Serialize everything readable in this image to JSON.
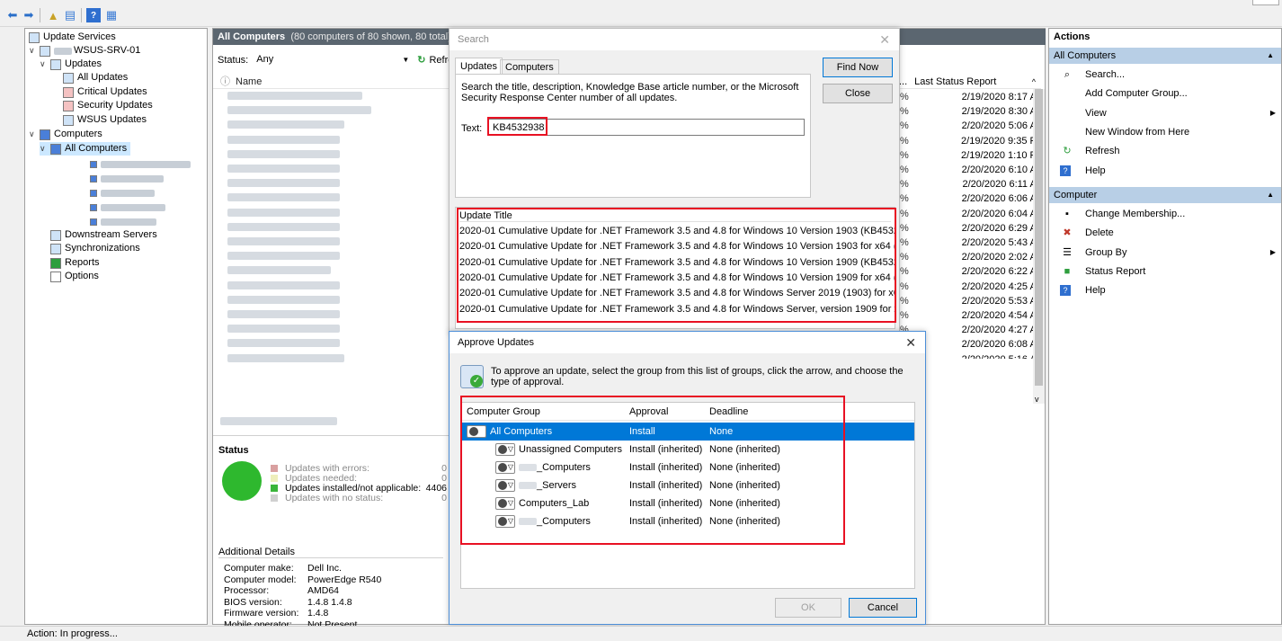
{
  "tree": {
    "items": [
      {
        "label": "Update Services"
      },
      {
        "label": "WSUS-SRV-01"
      },
      {
        "label": "Updates"
      },
      {
        "label": "All Updates"
      },
      {
        "label": "Critical Updates"
      },
      {
        "label": "Security Updates"
      },
      {
        "label": "WSUS Updates"
      },
      {
        "label": "Computers"
      },
      {
        "label": "All Computers"
      },
      {
        "label": "Downstream Servers"
      },
      {
        "label": "Synchronizations"
      },
      {
        "label": "Reports"
      },
      {
        "label": "Options"
      }
    ]
  },
  "center": {
    "title": "All Computers",
    "subtitle": "(80 computers of 80 shown, 80 total)",
    "status_label": "Status:",
    "status_value": "Any",
    "refresh_label": "Refresh",
    "col_name": "Name",
    "col_last_status": "Last Status Report",
    "col_ellipsis": "...",
    "pct_suffix": "%",
    "last_status": [
      "2/19/2020 8:17 AM",
      "2/19/2020 8:30 AM",
      "2/20/2020 5:06 AM",
      "2/19/2020 9:35 PM",
      "2/19/2020 1:10 PM",
      "2/20/2020 6:10 AM",
      "2/20/2020 6:11 AM",
      "2/20/2020 6:06 AM",
      "2/20/2020 6:04 AM",
      "2/20/2020 6:29 AM",
      "2/20/2020 5:43 AM",
      "2/20/2020 2:02 AM",
      "2/20/2020 6:22 AM",
      "2/20/2020 4:25 AM",
      "2/20/2020 5:53 AM",
      "2/20/2020 4:54 AM",
      "2/20/2020 4:27 AM",
      "2/20/2020 6:08 AM",
      "2/20/2020 5:16 AM"
    ],
    "summary": {
      "status_heading": "Status",
      "legend": [
        {
          "label": "Updates with errors:",
          "value": "0",
          "color": "#d9a0a0"
        },
        {
          "label": "Updates needed:",
          "value": "0",
          "color": "#eeeebb"
        },
        {
          "label": "Updates installed/not applicable:",
          "value": "4406",
          "color": "#3ab53a"
        },
        {
          "label": "Updates with no status:",
          "value": "0",
          "color": "#d0d0d0"
        }
      ],
      "details_heading": "Additional Details",
      "details": [
        {
          "k": "Computer make:",
          "v": "Dell Inc."
        },
        {
          "k": "Computer model:",
          "v": "PowerEdge R540"
        },
        {
          "k": "Processor:",
          "v": "AMD64"
        },
        {
          "k": "BIOS version:",
          "v": "1.4.8 1.4.8"
        },
        {
          "k": "Firmware version:",
          "v": "1.4.8"
        },
        {
          "k": "Mobile operator:",
          "v": "Not Present"
        }
      ]
    }
  },
  "actions": {
    "title": "Actions",
    "section1": "All Computers",
    "items1": [
      {
        "label": "Search...",
        "icon": "search-icon"
      },
      {
        "label": "Add Computer Group...",
        "icon": ""
      },
      {
        "label": "View",
        "icon": "",
        "submenu": true
      },
      {
        "label": "New Window from Here",
        "icon": ""
      },
      {
        "label": "Refresh",
        "icon": "refresh-icon"
      },
      {
        "label": "Help",
        "icon": "help-icon"
      }
    ],
    "section2": "Computer",
    "items2": [
      {
        "label": "Change Membership...",
        "icon": "computer-icon"
      },
      {
        "label": "Delete",
        "icon": "delete-icon"
      },
      {
        "label": "Group By",
        "icon": "group-icon",
        "submenu": true
      },
      {
        "label": "Status Report",
        "icon": "report-icon"
      },
      {
        "label": "Help",
        "icon": "help-icon"
      }
    ]
  },
  "search_dialog": {
    "title": "Search",
    "tab_updates": "Updates",
    "tab_computers": "Computers",
    "description": "Search the title, description, Knowledge Base article number, or the Microsoft Security Response Center number of all updates.",
    "text_label": "Text:",
    "text_value": "KB4532938",
    "find_now": "Find Now",
    "close": "Close",
    "results_header": "Update Title",
    "results": [
      "2020-01 Cumulative Update for .NET Framework 3.5 and 4.8 for Windows 10 Version 1903 (KB4532938)",
      "2020-01 Cumulative Update for .NET Framework 3.5 and 4.8 for Windows 10 Version 1903 for x64 (KB4...",
      "2020-01 Cumulative Update for .NET Framework 3.5 and 4.8 for Windows 10 Version 1909 (KB4532938)",
      "2020-01 Cumulative Update for .NET Framework 3.5 and 4.8 for Windows 10 Version 1909 for x64 (KB4...",
      "2020-01 Cumulative Update for .NET Framework 3.5 and 4.8 for Windows Server 2019 (1903) for x64 (K...",
      "2020-01 Cumulative Update for .NET Framework 3.5 and 4.8 for Windows Server, version 1909 for x64 (..."
    ]
  },
  "approve_dialog": {
    "title": "Approve Updates",
    "instruction": "To approve an update, select the group from this list of groups, click the arrow, and choose the type of approval.",
    "col_group": "Computer Group",
    "col_approval": "Approval",
    "col_deadline": "Deadline",
    "rows": [
      {
        "group": "All Computers",
        "approval": "Install",
        "deadline": "None"
      },
      {
        "group": "Unassigned Computers",
        "approval": "Install (inherited)",
        "deadline": "None (inherited)"
      },
      {
        "group": "_Computers",
        "approval": "Install (inherited)",
        "deadline": "None (inherited)"
      },
      {
        "group": "_Servers",
        "approval": "Install (inherited)",
        "deadline": "None (inherited)"
      },
      {
        "group": "Computers_Lab",
        "approval": "Install (inherited)",
        "deadline": "None (inherited)"
      },
      {
        "group": "_Computers",
        "approval": "Install (inherited)",
        "deadline": "None (inherited)"
      }
    ],
    "ok": "OK",
    "cancel": "Cancel"
  },
  "statusbar": {
    "text": "Action:  In progress..."
  },
  "colors": {
    "selection": "#0078d7",
    "highlight": "#e81123",
    "header": "#5b6670"
  }
}
